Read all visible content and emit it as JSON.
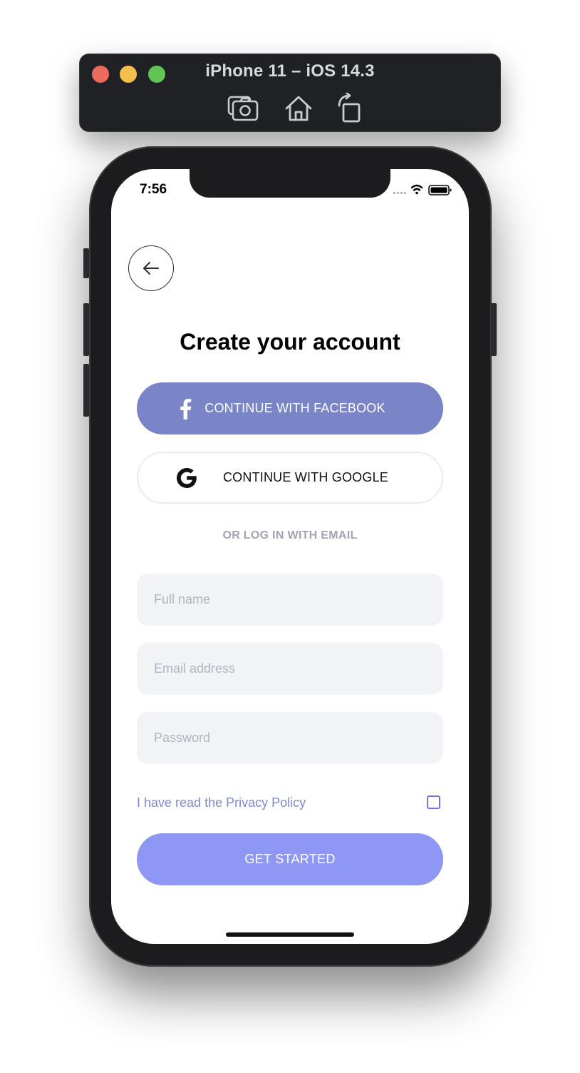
{
  "simulator": {
    "title": "iPhone 11 – iOS 14.3",
    "tools": [
      "screenshot-icon",
      "home-icon",
      "rotate-icon"
    ],
    "traffic_colors": [
      "#ed6a5e",
      "#f5bf4f",
      "#61c554"
    ]
  },
  "status_bar": {
    "time": "7:56",
    "icons": [
      "signal-icon",
      "wifi-icon",
      "battery-icon"
    ]
  },
  "screen": {
    "back_icon": "arrow-left-icon",
    "title": "Create your account",
    "facebook_button": "CONTINUE WITH FACEBOOK",
    "google_button": "CONTINUE WITH GOOGLE",
    "divider": "OR LOG IN WITH EMAIL",
    "fields": {
      "full_name": {
        "placeholder": "Full name",
        "value": ""
      },
      "email": {
        "placeholder": "Email address",
        "value": ""
      },
      "password": {
        "placeholder": "Password",
        "value": ""
      }
    },
    "privacy_label": "I have read the Privacy Policy",
    "privacy_checked": false,
    "submit_button": "GET STARTED"
  },
  "colors": {
    "facebook": "#7a85c7",
    "primary": "#8e97f4",
    "link": "#7e87d8",
    "field_bg": "#f2f3f7"
  }
}
